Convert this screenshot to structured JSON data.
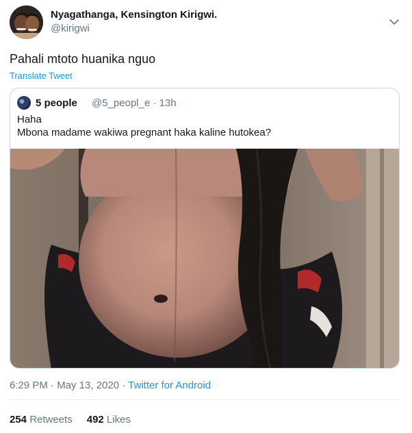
{
  "author": {
    "name": "Nyagathanga, Kensington Kirigwi.",
    "handle": "@kirigwi",
    "avatar_icon": "profile-photo-two-people"
  },
  "tweet": {
    "text": "Pahali mtoto huanika nguo",
    "translate_label": "Translate Tweet"
  },
  "quoted_tweet": {
    "author_name": "5 people",
    "meta": "@5_peopl_e · 13h",
    "line1": "Haha",
    "line2": "Mbona madame wakiwa pregnant haka kaline hutokea?",
    "media_icon": "photo-pregnant-belly"
  },
  "footer": {
    "timestamp": "6:29 PM · May 13, 2020 · ",
    "source": "Twitter for Android",
    "retweets_count": "254",
    "retweets_label": " Retweets",
    "likes_count": "492",
    "likes_label": " Likes"
  },
  "colors": {
    "link": "#1b95e0",
    "secondary_text": "#657786",
    "primary_text": "#14171a",
    "border": "#ccd6dd"
  }
}
